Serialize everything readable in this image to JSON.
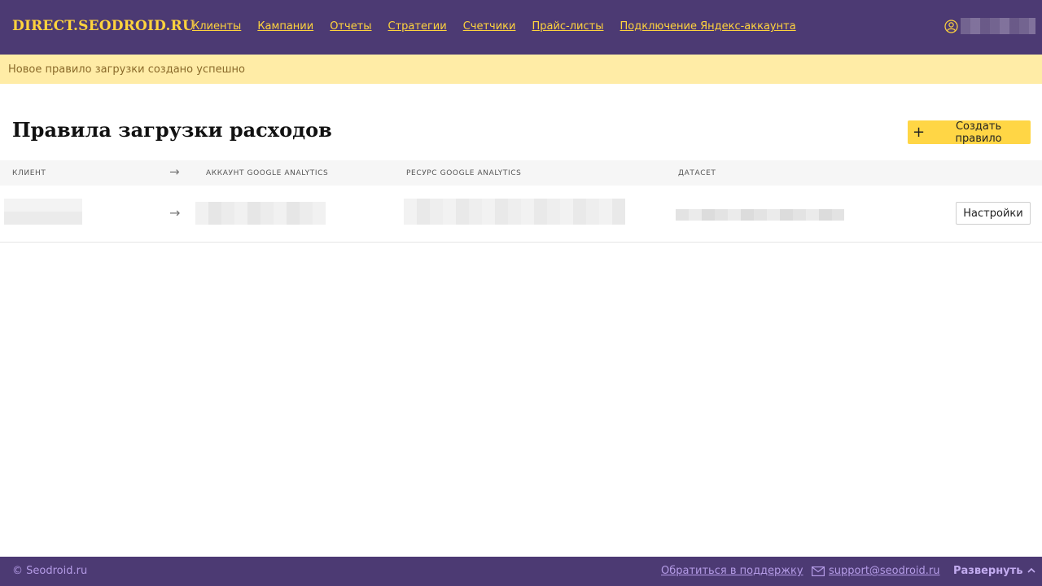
{
  "header": {
    "brand": "DIRECT.SEODROID.RU",
    "nav": [
      {
        "label": "Клиенты"
      },
      {
        "label": "Кампании"
      },
      {
        "label": "Отчеты"
      },
      {
        "label": "Стратегии"
      },
      {
        "label": "Счетчики"
      },
      {
        "label": "Прайс-листы"
      },
      {
        "label": "Подключение Яндекс-аккаунта"
      }
    ],
    "user_icon": "user-circle-icon"
  },
  "notice": {
    "text": "Новое правило загрузки создано успешно"
  },
  "page": {
    "title": "Правила загрузки расходов",
    "create_button": "Создать правило"
  },
  "table": {
    "columns": [
      "Клиент",
      "Аккаунт Google Analytics",
      "Ресурс Google Analytics",
      "Датасет"
    ],
    "arrow": "→",
    "rows": [
      {
        "settings_button": "Настройки"
      }
    ]
  },
  "footer": {
    "copyright": "© Seodroid.ru",
    "support_link": "Обратиться в поддержку",
    "email": "support@seodroid.ru",
    "expand": "Развернуть",
    "expand_icon": "chevron-up-icon",
    "mail_icon": "envelope-icon"
  },
  "colors": {
    "header_bg": "#4c3a73",
    "accent": "#ffd33d",
    "notice_bg": "#ffeca6",
    "footer_text": "#b49be6"
  }
}
